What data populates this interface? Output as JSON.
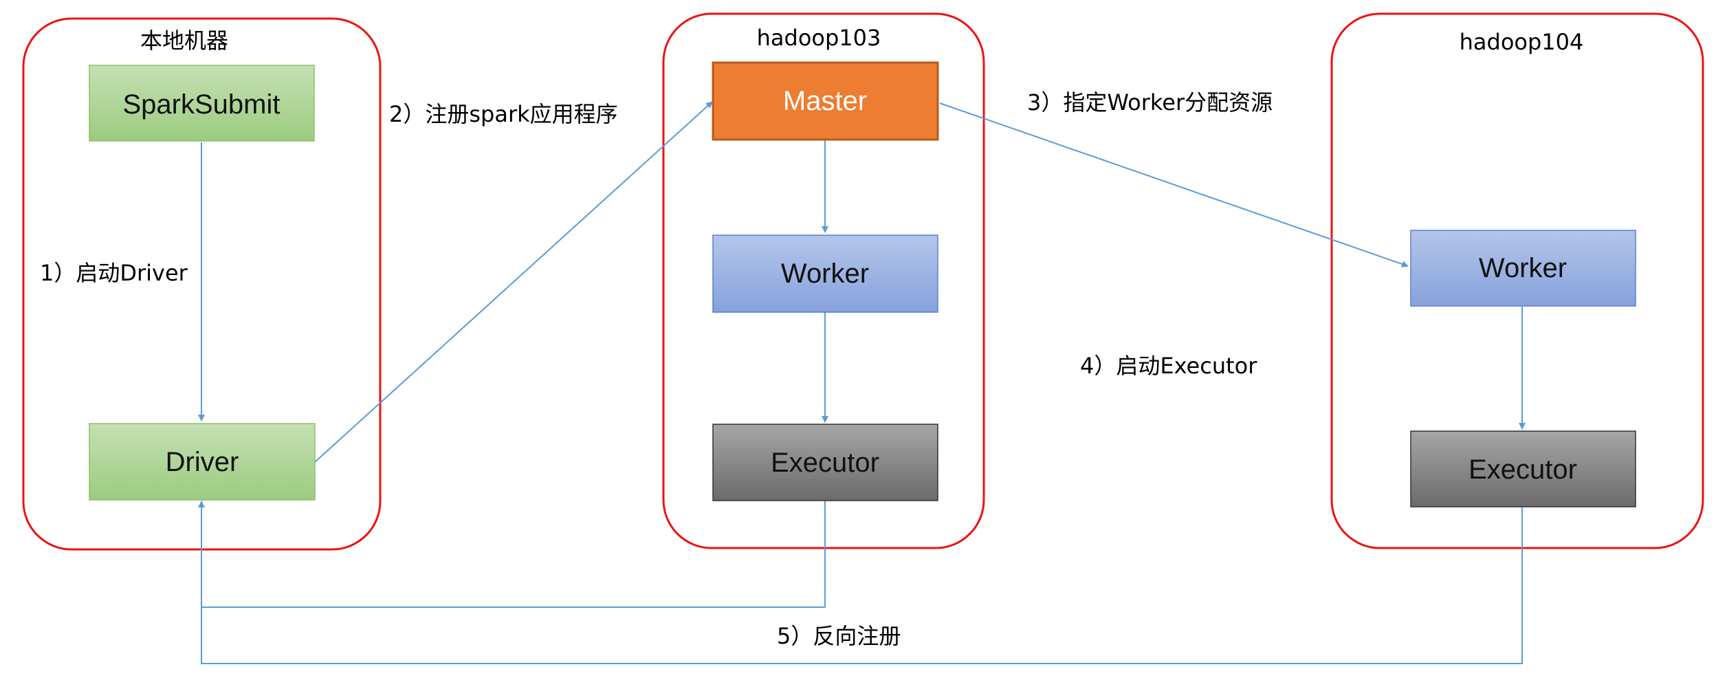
{
  "groups": {
    "local": {
      "title": "本地机器"
    },
    "h103": {
      "title": "hadoop103"
    },
    "h104": {
      "title": "hadoop104"
    }
  },
  "nodes": {
    "spark_submit": "SparkSubmit",
    "driver": "Driver",
    "master": "Master",
    "worker_103": "Worker",
    "executor_103": "Executor",
    "worker_104": "Worker",
    "executor_104": "Executor"
  },
  "edge_labels": {
    "step1": "1）启动Driver",
    "step2": "2）注册spark应用程序",
    "step3": "3）指定Worker分配资源",
    "step4": "4）启动Executor",
    "step5": "5）反向注册"
  },
  "colors": {
    "frame": "#ee1111",
    "green_node": "#a9d18e",
    "orange_node": "#ed7d31",
    "blue_node": "#8faadc",
    "gray_node": "#7f7f7f",
    "connector": "#5b9bd5"
  }
}
